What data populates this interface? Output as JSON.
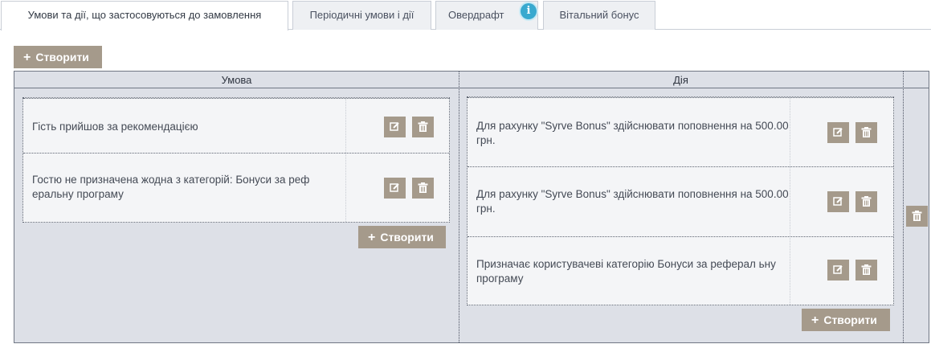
{
  "tabs": [
    {
      "label": "Умови та дії, що застосовуються до замовлення",
      "active": true
    },
    {
      "label": "Періодичні умови і дії",
      "active": false
    },
    {
      "label": "Овердрафт",
      "active": false
    },
    {
      "label": "Вітальний бонус",
      "active": false
    }
  ],
  "info_icon": "i",
  "toolbar": {
    "create_label": "Створити"
  },
  "table": {
    "headers": {
      "condition": "Умова",
      "action": "Дія"
    },
    "conditions": [
      {
        "text": "Гість прийшов за рекомендацією"
      },
      {
        "text": "Гостю не призначена жодна з категорій: Бонуси за реф еральну програму"
      }
    ],
    "actions": [
      {
        "text": "Для рахунку \"Syrve Bonus\" здійснювати поповнення на 500.00 грн."
      },
      {
        "text": "Для рахунку \"Syrve Bonus\" здійснювати поповнення на 500.00 грн."
      },
      {
        "text": "Призначає користувачеві категорію Бонуси за реферал ьну програму"
      }
    ],
    "conditions_create_label": "Створити",
    "actions_create_label": "Створити"
  },
  "icons": {
    "edit": "edit-icon",
    "delete": "trash-icon",
    "plus": "plus-icon"
  },
  "colors": {
    "button": "#a59a8b",
    "grid_bg": "#dde0e7",
    "panel_bg": "#f4f5f7",
    "info": "#39a9cf"
  }
}
